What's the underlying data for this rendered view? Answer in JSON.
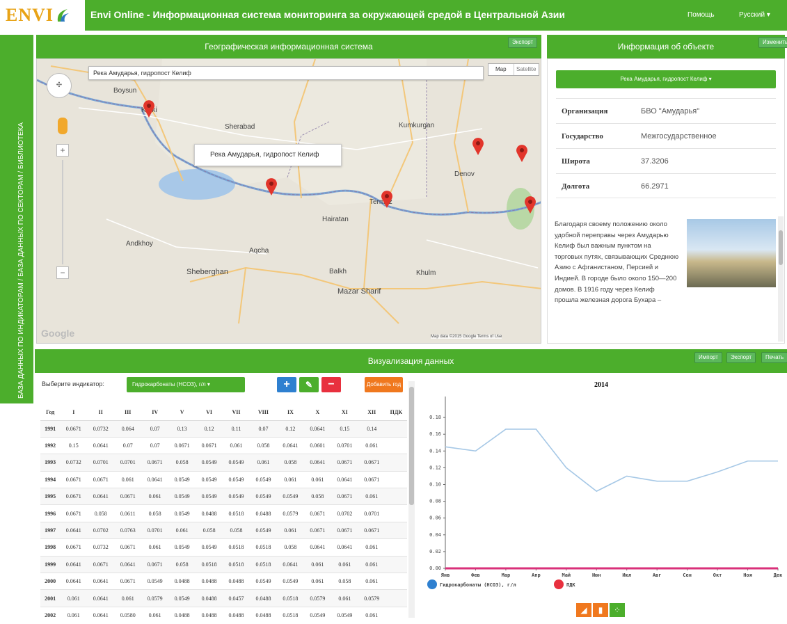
{
  "header": {
    "logo_text": "ENVI",
    "title": "Envi Online - Информационная система мониторинга за окружающей средой в Центральной Азии",
    "help": "Помощь",
    "language": "Русский ▾"
  },
  "sidebar": {
    "label": "БАЗА ДАННЫХ ПО ИНДИКАТОРАМ   /   БАЗА ДАННЫХ ПО СЕКТОРАМ   /   БИБЛИОТЕКА"
  },
  "gis_panel": {
    "title": "Географическая информационная система",
    "export": "Экспорт"
  },
  "map": {
    "search_value": "Река Амударья, гидропост Келиф",
    "type_map": "Map",
    "type_sat": "Satellite",
    "popup": "Река Амударья, гидропост Келиф",
    "places": [
      "Sheberghan",
      "Mazar Sharif",
      "Balkh",
      "Khulm",
      "Termez",
      "Kerki",
      "Sherabad",
      "Boysun",
      "Denov",
      "Kumkurgan",
      "Andkhoy",
      "Aqcha",
      "Hairatan"
    ],
    "attribution": "Map data ©2015 Google   Terms of Use",
    "google": "Google"
  },
  "info_panel": {
    "title": "Информация об объекте",
    "edit": "Изменить",
    "dropdown": "Река Амударья, гидропост Келиф ▾",
    "rows": [
      {
        "k": "Организация",
        "v": "БВО \"Амударья\""
      },
      {
        "k": "Государство",
        "v": "Межгосударственное"
      },
      {
        "k": "Широта",
        "v": "37.3206"
      },
      {
        "k": "Долгота",
        "v": "66.2971"
      }
    ],
    "description": "Благодаря своему положению около удобной переправы через Амударью Келиф был важным пунктом на торговых путях, связывающих Среднюю Азию с Афганистаном, Персией и Индией. В городе было около 150—200 домов. В 1916 году через Келиф прошла железная дорога Бухара –"
  },
  "viz_panel": {
    "title": "Визуализация данных",
    "import": "Импорт",
    "export": "Экспорт",
    "print": "Печать",
    "indicator_label": "Выберите индикатор:",
    "indicator_value": "Гидрокарбонаты (HCO3), г/л ▾",
    "add_year": "Добавить год"
  },
  "table": {
    "headers": [
      "Год",
      "I",
      "II",
      "III",
      "IV",
      "V",
      "VI",
      "VII",
      "VIII",
      "IX",
      "X",
      "XI",
      "XII",
      "ПДК"
    ],
    "rows": [
      [
        "1991",
        "0.0671",
        "0.0732",
        "0.064",
        "0.07",
        "0.13",
        "0.12",
        "0.11",
        "0.07",
        "0.12",
        "0.0641",
        "0.15",
        "0.14",
        ""
      ],
      [
        "1992",
        "0.15",
        "0.0641",
        "0.07",
        "0.07",
        "0.0671",
        "0.0671",
        "0.061",
        "0.058",
        "0.0641",
        "0.0601",
        "0.0701",
        "0.061",
        ""
      ],
      [
        "1993",
        "0.0732",
        "0.0701",
        "0.0701",
        "0.0671",
        "0.058",
        "0.0549",
        "0.0549",
        "0.061",
        "0.058",
        "0.0641",
        "0.0671",
        "0.0671",
        ""
      ],
      [
        "1994",
        "0.0671",
        "0.0671",
        "0.061",
        "0.0641",
        "0.0549",
        "0.0549",
        "0.0549",
        "0.0549",
        "0.061",
        "0.061",
        "0.0641",
        "0.0671",
        ""
      ],
      [
        "1995",
        "0.0671",
        "0.0641",
        "0.0671",
        "0.061",
        "0.0549",
        "0.0549",
        "0.0549",
        "0.0549",
        "0.0549",
        "0.058",
        "0.0671",
        "0.061",
        ""
      ],
      [
        "1996",
        "0.0671",
        "0.058",
        "0.0611",
        "0.058",
        "0.0549",
        "0.0488",
        "0.0518",
        "0.0488",
        "0.0579",
        "0.0671",
        "0.0702",
        "0.0701",
        ""
      ],
      [
        "1997",
        "0.0641",
        "0.0702",
        "0.0763",
        "0.0701",
        "0.061",
        "0.058",
        "0.058",
        "0.0549",
        "0.061",
        "0.0671",
        "0.0671",
        "0.0671",
        ""
      ],
      [
        "1998",
        "0.0671",
        "0.0732",
        "0.0671",
        "0.061",
        "0.0549",
        "0.0549",
        "0.0518",
        "0.0518",
        "0.058",
        "0.0641",
        "0.0641",
        "0.061",
        ""
      ],
      [
        "1999",
        "0.0641",
        "0.0671",
        "0.0641",
        "0.0671",
        "0.058",
        "0.0518",
        "0.0518",
        "0.0518",
        "0.0641",
        "0.061",
        "0.061",
        "0.061",
        ""
      ],
      [
        "2000",
        "0.0641",
        "0.0641",
        "0.0671",
        "0.0549",
        "0.0488",
        "0.0488",
        "0.0488",
        "0.0549",
        "0.0549",
        "0.061",
        "0.058",
        "0.061",
        ""
      ],
      [
        "2001",
        "0.061",
        "0.0641",
        "0.061",
        "0.0579",
        "0.0549",
        "0.0488",
        "0.0457",
        "0.0488",
        "0.0518",
        "0.0579",
        "0.061",
        "0.0579",
        ""
      ],
      [
        "2002",
        "0.061",
        "0.0641",
        "0.0580",
        "0.061",
        "0.0488",
        "0.0488",
        "0.0488",
        "0.0488",
        "0.0518",
        "0.0549",
        "0.0549",
        "0.061",
        ""
      ]
    ]
  },
  "chart_data": {
    "type": "line",
    "title": "2014",
    "categories": [
      "Янв",
      "Фев",
      "Мар",
      "Апр",
      "Май",
      "Июн",
      "Июл",
      "Авг",
      "Сен",
      "Окт",
      "Ноя",
      "Дек"
    ],
    "ylim": [
      0,
      0.2
    ],
    "yticks": [
      "0.00",
      "0.02",
      "0.04",
      "0.06",
      "0.08",
      "0.10",
      "0.12",
      "0.14",
      "0.16",
      "0.18"
    ],
    "series": [
      {
        "name": "Гидрокарбонаты (HCO3), г/л",
        "color": "#a6c8e6",
        "values": [
          0.145,
          0.14,
          0.166,
          0.166,
          0.12,
          0.092,
          0.11,
          0.104,
          0.104,
          0.115,
          0.128,
          0.128
        ]
      },
      {
        "name": "ПДК",
        "color": "#d9307a",
        "values": [
          0,
          0,
          0,
          0,
          0,
          0,
          0,
          0,
          0,
          0,
          0,
          0
        ]
      }
    ],
    "grid": false,
    "legend": "bottom-left"
  }
}
